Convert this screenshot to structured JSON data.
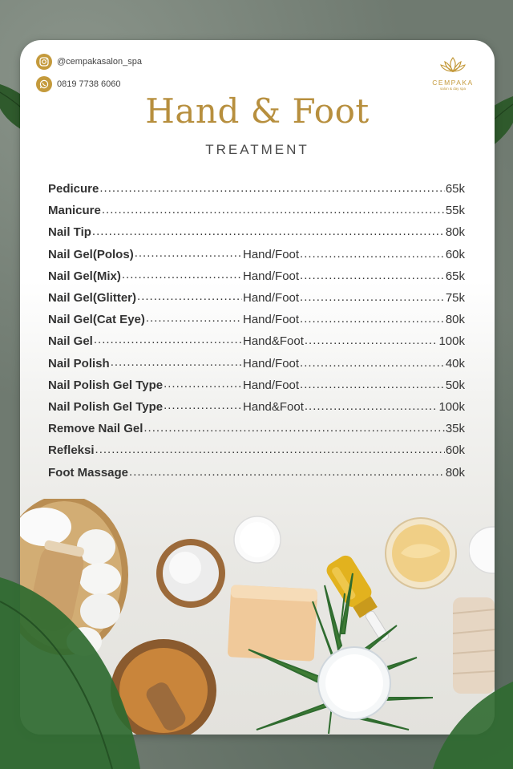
{
  "contacts": {
    "instagram": "@cempakasalon_spa",
    "whatsapp": "0819 7738 6060"
  },
  "logo": {
    "brand": "CEMPAKA",
    "tagline": "salon & day spa"
  },
  "header": {
    "title": "Hand & Foot",
    "subtitle": "TREATMENT"
  },
  "menu": [
    {
      "name": "Pedicure",
      "type": "",
      "price": "65k"
    },
    {
      "name": "Manicure",
      "type": "",
      "price": "55k"
    },
    {
      "name": "Nail Tip",
      "type": "",
      "price": "80k"
    },
    {
      "name": "Nail Gel(Polos)",
      "type": "Hand/Foot",
      "price": "60k"
    },
    {
      "name": "Nail Gel(Mix)",
      "type": "Hand/Foot",
      "price": "65k"
    },
    {
      "name": "Nail Gel(Glitter)",
      "type": "Hand/Foot",
      "price": "75k"
    },
    {
      "name": "Nail Gel(Cat Eye)",
      "type": "Hand/Foot",
      "price": "80k"
    },
    {
      "name": "Nail Gel",
      "type": "Hand&Foot",
      "price": "100k"
    },
    {
      "name": "Nail Polish",
      "type": "Hand/Foot",
      "price": "40k"
    },
    {
      "name": "Nail Polish Gel Type",
      "type": "Hand/Foot",
      "price": "50k"
    },
    {
      "name": "Nail Polish Gel Type",
      "type": "Hand&Foot",
      "price": "100k"
    },
    {
      "name": "Remove Nail Gel",
      "type": "",
      "price": "35k"
    },
    {
      "name": "Refleksi",
      "type": "",
      "price": "60k"
    },
    {
      "name": "Foot Massage",
      "type": "",
      "price": "80k"
    }
  ],
  "icons": {
    "instagram": "instagram-icon",
    "whatsapp": "whatsapp-icon",
    "logo": "lotus-icon"
  },
  "colors": {
    "gold": "#b78f3e",
    "icon_gold": "#c49a3c",
    "text": "#333333"
  }
}
